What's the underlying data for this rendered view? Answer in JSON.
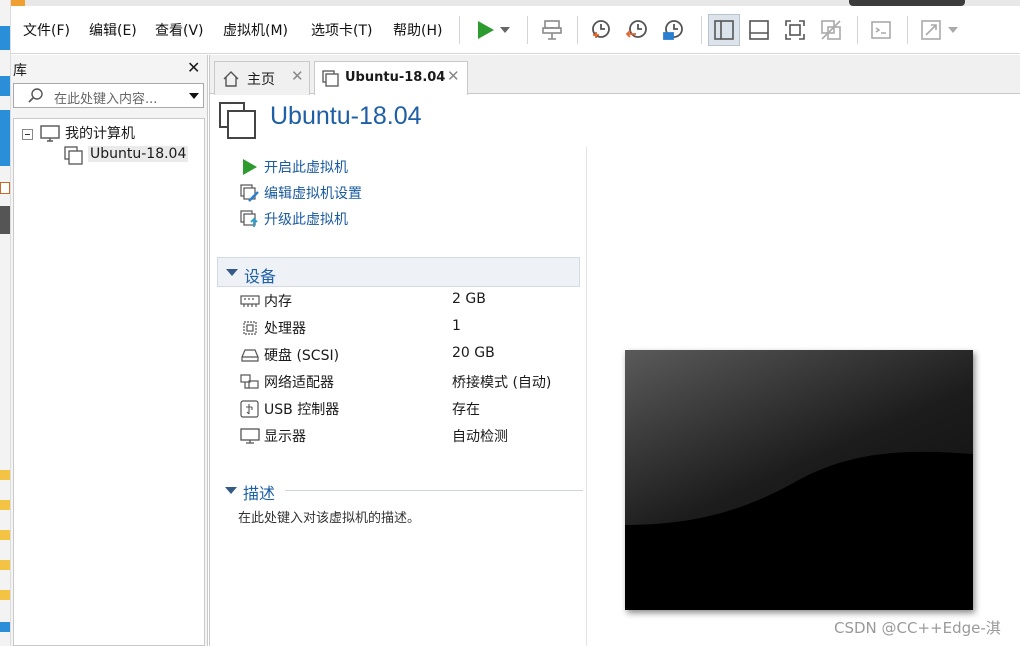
{
  "menubar": {
    "items": [
      "文件(F)",
      "编辑(E)",
      "查看(V)",
      "虚拟机(M)",
      "选项卡(T)",
      "帮助(H)"
    ]
  },
  "toolbar": {
    "icons": [
      "play-icon",
      "dropdown-arrow-icon",
      "send-ctrl-alt-del-icon",
      "snapshot-take-icon",
      "snapshot-revert-icon",
      "snapshot-manager-icon",
      "show-library-icon",
      "thumbnail-bar-icon",
      "fullscreen-icon",
      "unity-icon",
      "console-icon",
      "stretch-icon"
    ]
  },
  "library": {
    "title": "库",
    "search_placeholder": "在此处键入内容...",
    "tree": {
      "root": "我的计算机",
      "child": "Ubuntu-18.04"
    }
  },
  "tabs": [
    {
      "label": "主页",
      "active": false
    },
    {
      "label": "Ubuntu-18.04",
      "active": true
    }
  ],
  "vm": {
    "title": "Ubuntu-18.04",
    "actions": [
      "开启此虚拟机",
      "编辑虚拟机设置",
      "升级此虚拟机"
    ],
    "devices_header": "设备",
    "devices": [
      {
        "name": "内存",
        "value": "2 GB",
        "icon": "memory-icon"
      },
      {
        "name": "处理器",
        "value": "1",
        "icon": "cpu-icon"
      },
      {
        "name": "硬盘 (SCSI)",
        "value": "20 GB",
        "icon": "hard-disk-icon"
      },
      {
        "name": "网络适配器",
        "value": "桥接模式 (自动)",
        "icon": "network-adapter-icon"
      },
      {
        "name": "USB 控制器",
        "value": "存在",
        "icon": "usb-icon"
      },
      {
        "name": "显示器",
        "value": "自动检测",
        "icon": "display-icon"
      }
    ],
    "description_header": "描述",
    "description_placeholder": "在此处键入对该虚拟机的描述。"
  },
  "watermark": "CSDN @CC++Edge-淇",
  "colors": {
    "accent_blue": "#1e5fa6",
    "play_green": "#2e9b2e",
    "snapshot_orange": "#e8642a"
  }
}
